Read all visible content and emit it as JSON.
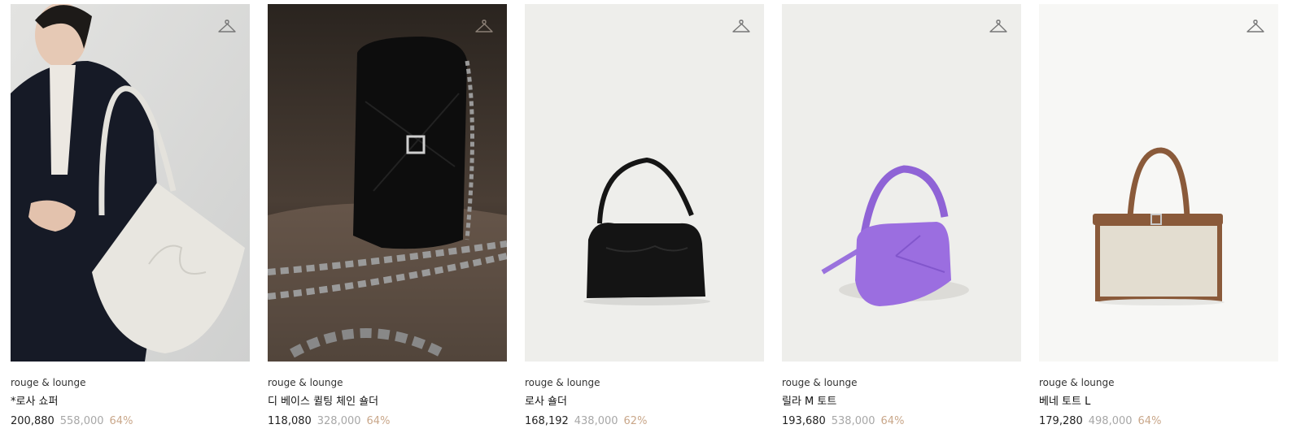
{
  "colors": {
    "discount": "#c9a78a",
    "original_price": "#a7a7a7",
    "price": "#222222"
  },
  "products": [
    {
      "brand": "rouge & lounge",
      "name": "*로사 쇼퍼",
      "price": "200,880",
      "original_price": "558,000",
      "discount": "64%",
      "wishlist_icon": "hanger-icon"
    },
    {
      "brand": "rouge & lounge",
      "name": "디 베이스 퀼팅 체인 숄더",
      "price": "118,080",
      "original_price": "328,000",
      "discount": "64%",
      "wishlist_icon": "hanger-icon"
    },
    {
      "brand": "rouge & lounge",
      "name": "로사 숄더",
      "price": "168,192",
      "original_price": "438,000",
      "discount": "62%",
      "wishlist_icon": "hanger-icon"
    },
    {
      "brand": "rouge & lounge",
      "name": "릴라 M 토트",
      "price": "193,680",
      "original_price": "538,000",
      "discount": "64%",
      "wishlist_icon": "hanger-icon"
    },
    {
      "brand": "rouge & lounge",
      "name": "베네 토트 L",
      "price": "179,280",
      "original_price": "498,000",
      "discount": "64%",
      "wishlist_icon": "hanger-icon"
    }
  ]
}
